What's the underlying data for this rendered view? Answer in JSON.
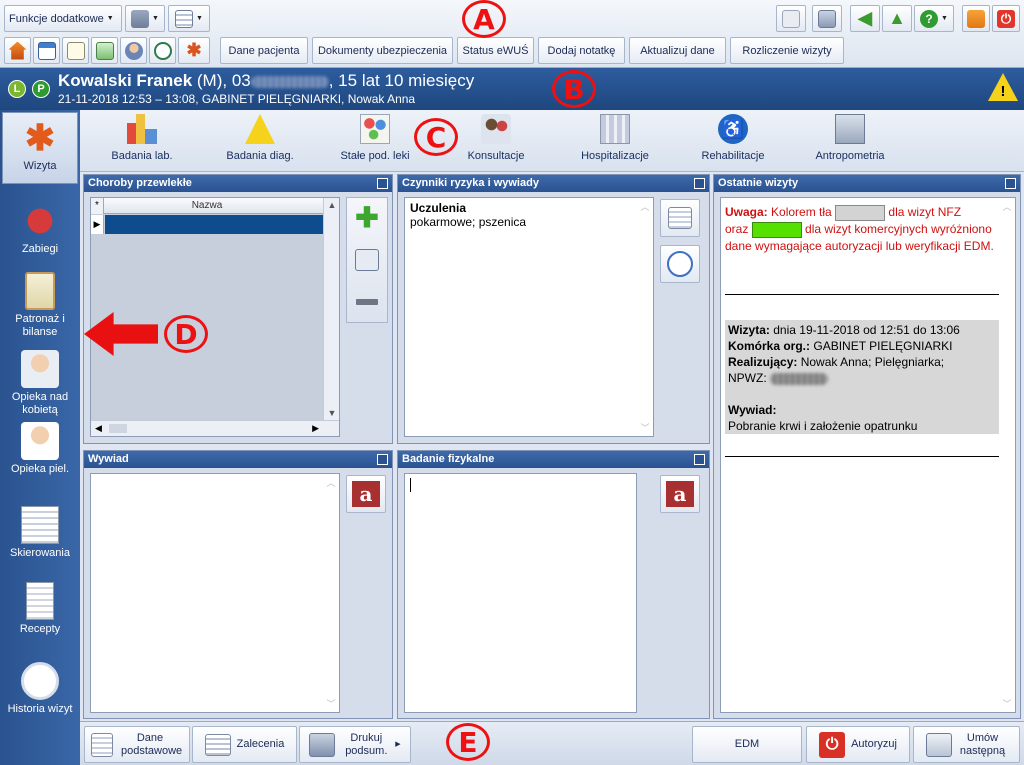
{
  "toolbar": {
    "funkcje_label": "Funkcje dodatkowe",
    "buttons": [
      "Dane pacjenta",
      "Dokumenty ubezpieczenia",
      "Status eWUŚ",
      "Dodaj notatkę",
      "Aktualizuj dane",
      "Rozliczenie wizyty"
    ]
  },
  "patient": {
    "badge_l": "L",
    "badge_p": "P",
    "name": "Kowalski Franek",
    "sex": " (M), 03",
    "age": ", 15 lat 10 miesięcy",
    "visit": "21-11-2018 12:53 – 13:08, GABINET PIELĘGNIARKI, Nowak Anna"
  },
  "sidebar": {
    "items": [
      "Wizyta",
      "Zabiegi",
      "Patronaż i bilanse",
      "Opieka nad kobietą",
      "Opieka piel.",
      "Skierowania",
      "Recepty",
      "Historia wizyt"
    ]
  },
  "modules": [
    "Badania lab.",
    "Badania diag.",
    "Stałe pod. leki",
    "Konsultacje",
    "Hospitalizacje",
    "Rehabilitacje",
    "Antropometria"
  ],
  "panels": {
    "choroby": {
      "title": "Choroby przewlekłe",
      "column": "Nazwa",
      "star": "*"
    },
    "czynniki": {
      "title": "Czynniki ryzyka i wywiady",
      "heading": "Uczulenia",
      "text": "pokarmowe; pszenica"
    },
    "ostatnie": {
      "title": "Ostatnie wizyty",
      "uwaga_label": "Uwaga:",
      "uwaga_1": "Kolorem tła",
      "uwaga_2": "dla wizyt NFZ",
      "uwaga_3": "oraz",
      "uwaga_4": "dla wizyt komercyjnych wyróżniono dane wymagające autoryzacji lub weryfikacji EDM.",
      "wizyta_label": "Wizyta:",
      "wizyta_value": "dnia 19-11-2018 od 12:51 do 13:06",
      "komorka_label": "Komórka org.:",
      "komorka_value": "GABINET PIELĘGNIARKI",
      "realizujacy_label": "Realizujący:",
      "realizujacy_value": "Nowak Anna; Pielęgniarka;",
      "npwz_label": "NPWZ:",
      "wywiad_label": "Wywiad:",
      "wywiad_value": "Pobranie krwi i założenie opatrunku",
      "nfz_color": "#d3d3d3",
      "commercial_color": "#55e000"
    },
    "wywiad": {
      "title": "Wywiad"
    },
    "badanie": {
      "title": "Badanie fizykalne"
    }
  },
  "bottom": {
    "dane": "Dane podstawowe",
    "zalecenia": "Zalecenia",
    "drukuj": "Drukuj podsum.",
    "edm": "EDM",
    "autoryzuj": "Autoryzuj",
    "umow": "Umów następną"
  },
  "markers": {
    "a": "A",
    "b": "B",
    "c": "C",
    "d": "D",
    "e": "E"
  }
}
